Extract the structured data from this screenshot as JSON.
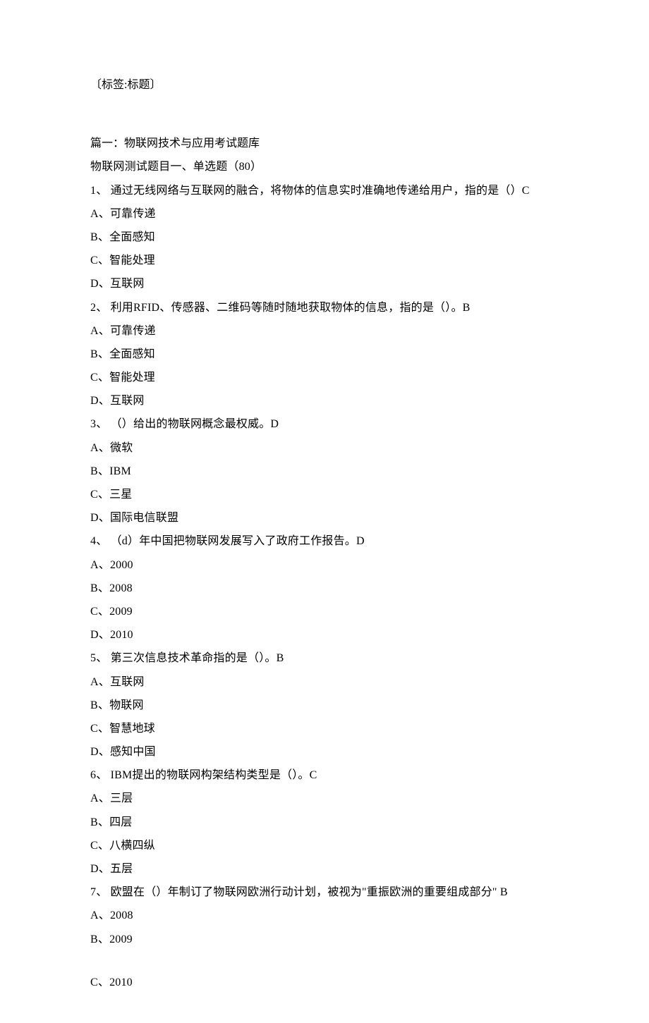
{
  "header": {
    "tag": "〔标签:标题〕"
  },
  "section": {
    "title": "篇一：物联网技术与应用考试题库",
    "subtitle": " 物联网测试题目一、单选题（80）"
  },
  "questions": [
    {
      "q": " 1、 通过无线网络与互联网的融合，将物体的信息实时准确地传递给用户，指的是（）C",
      "options": [
        " A、可靠传递",
        " B、全面感知",
        " C、智能处理",
        " D、互联网"
      ]
    },
    {
      "q": " 2、 利用RFID、传感器、二维码等随时随地获取物体的信息，指的是（）。B",
      "options": [
        " A、可靠传递",
        " B、全面感知",
        " C、智能处理",
        " D、互联网"
      ]
    },
    {
      "q": " 3、 （）给出的物联网概念最权威。D",
      "options": [
        " A、微软",
        " B、IBM",
        " C、三星",
        " D、国际电信联盟"
      ]
    },
    {
      "q": " 4、 （d）年中国把物联网发展写入了政府工作报告。D",
      "options": [
        " A、2000",
        " B、2008",
        " C、2009",
        " D、2010"
      ]
    },
    {
      "q": " 5、 第三次信息技术革命指的是（）。B",
      "options": [
        " A、互联网",
        " B、物联网",
        " C、智慧地球",
        " D、感知中国"
      ]
    },
    {
      "q": " 6、 IBM提出的物联网构架结构类型是（）。C",
      "options": [
        " A、三层",
        " B、四层",
        " C、八横四纵",
        " D、五层"
      ]
    },
    {
      "q": " 7、 欧盟在（）年制订了物联网欧洲行动计划，被视为\"重振欧洲的重要组成部分\"  B",
      "options": [
        " A、2008",
        " B、2009"
      ],
      "extra": " C、2010"
    }
  ]
}
